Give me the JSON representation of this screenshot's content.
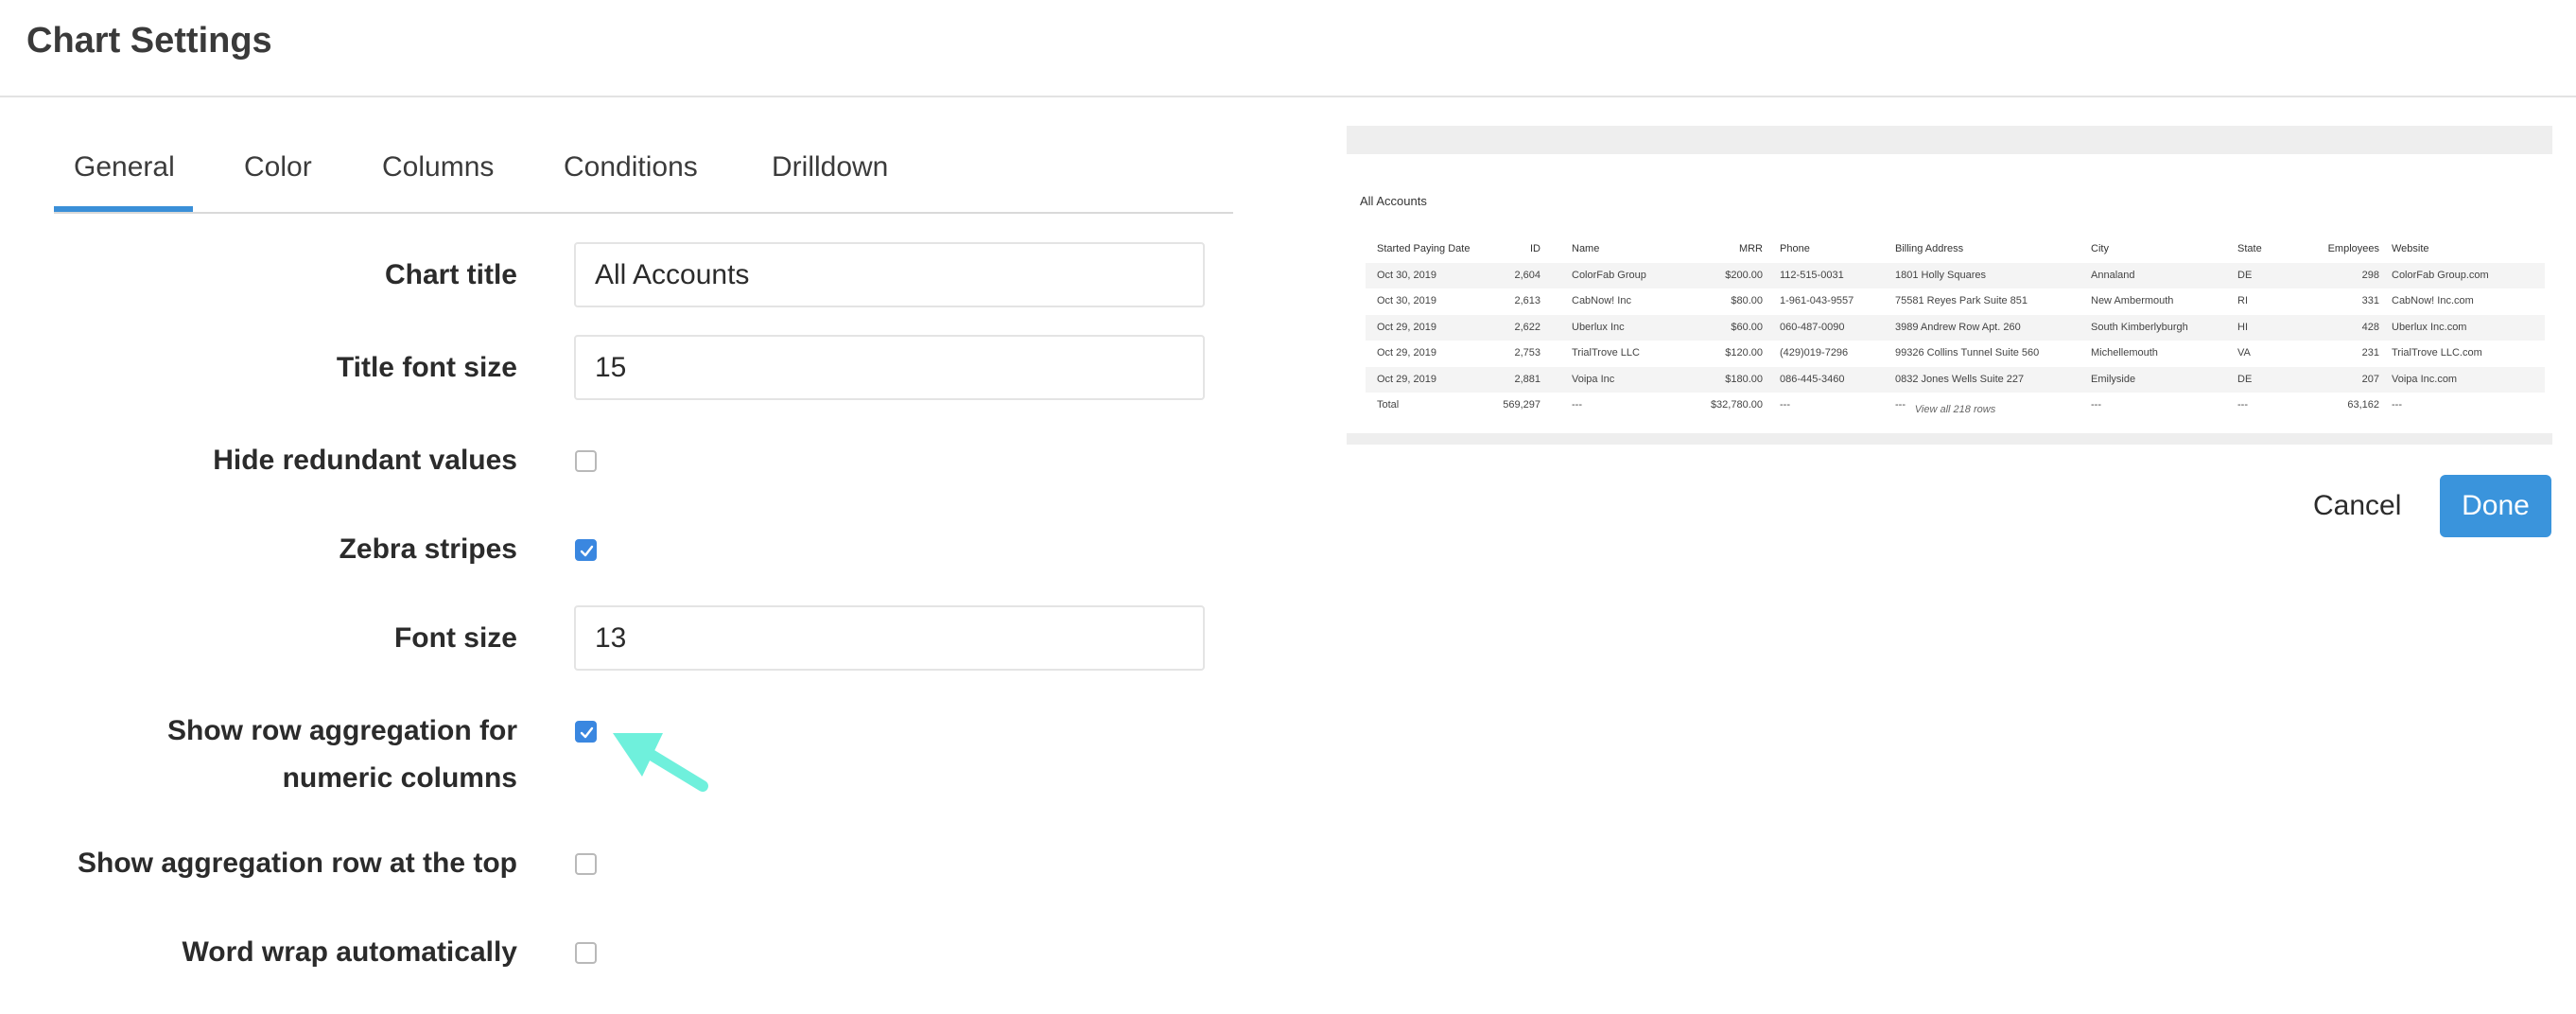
{
  "header": {
    "title": "Chart Settings"
  },
  "tabs": [
    {
      "label": "General",
      "active": true
    },
    {
      "label": "Color"
    },
    {
      "label": "Columns"
    },
    {
      "label": "Conditions"
    },
    {
      "label": "Drilldown"
    }
  ],
  "settings": {
    "chart_title": {
      "label": "Chart title",
      "value": "All Accounts"
    },
    "title_font_size": {
      "label": "Title font size",
      "value": "15"
    },
    "hide_redundant": {
      "label": "Hide redundant values",
      "checked": false
    },
    "zebra": {
      "label": "Zebra stripes",
      "checked": true
    },
    "font_size": {
      "label": "Font size",
      "value": "13"
    },
    "row_aggregation": {
      "label_line1": "Show row aggregation for",
      "label_line2": "numeric columns",
      "checked": true
    },
    "aggregation_top": {
      "label": "Show aggregation row at the top",
      "checked": false
    },
    "word_wrap": {
      "label": "Word wrap automatically",
      "checked": false
    }
  },
  "preview": {
    "title": "All Accounts",
    "columns": [
      "Started Paying Date",
      "ID",
      "Name",
      "MRR",
      "Phone",
      "Billing Address",
      "City",
      "State",
      "Employees",
      "Website"
    ],
    "rows": [
      [
        "Oct 30, 2019",
        "2,604",
        "ColorFab Group",
        "$200.00",
        "112-515-0031",
        "1801 Holly Squares",
        "Annaland",
        "DE",
        "298",
        "ColorFab Group.com"
      ],
      [
        "Oct 30, 2019",
        "2,613",
        "CabNow! Inc",
        "$80.00",
        "1-961-043-9557",
        "75581 Reyes Park Suite 851",
        "New Ambermouth",
        "RI",
        "331",
        "CabNow! Inc.com"
      ],
      [
        "Oct 29, 2019",
        "2,622",
        "Uberlux Inc",
        "$60.00",
        "060-487-0090",
        "3989 Andrew Row Apt. 260",
        "South Kimberlyburgh",
        "HI",
        "428",
        "Uberlux Inc.com"
      ],
      [
        "Oct 29, 2019",
        "2,753",
        "TrialTrove LLC",
        "$120.00",
        "(429)019-7296",
        "99326 Collins Tunnel Suite 560",
        "Michellemouth",
        "VA",
        "231",
        "TrialTrove LLC.com"
      ],
      [
        "Oct 29, 2019",
        "2,881",
        "Voipa Inc",
        "$180.00",
        "086-445-3460",
        "0832 Jones Wells Suite 227",
        "Emilyside",
        "DE",
        "207",
        "Voipa Inc.com"
      ]
    ],
    "total": [
      "Total",
      "569,297",
      "---",
      "$32,780.00",
      "---",
      "---",
      "---",
      "---",
      "63,162",
      "---"
    ],
    "footer": "View all 218 rows"
  },
  "actions": {
    "cancel": "Cancel",
    "done": "Done"
  },
  "colors": {
    "accent": "#3a94dc",
    "arrow": "#6ff0dc"
  }
}
